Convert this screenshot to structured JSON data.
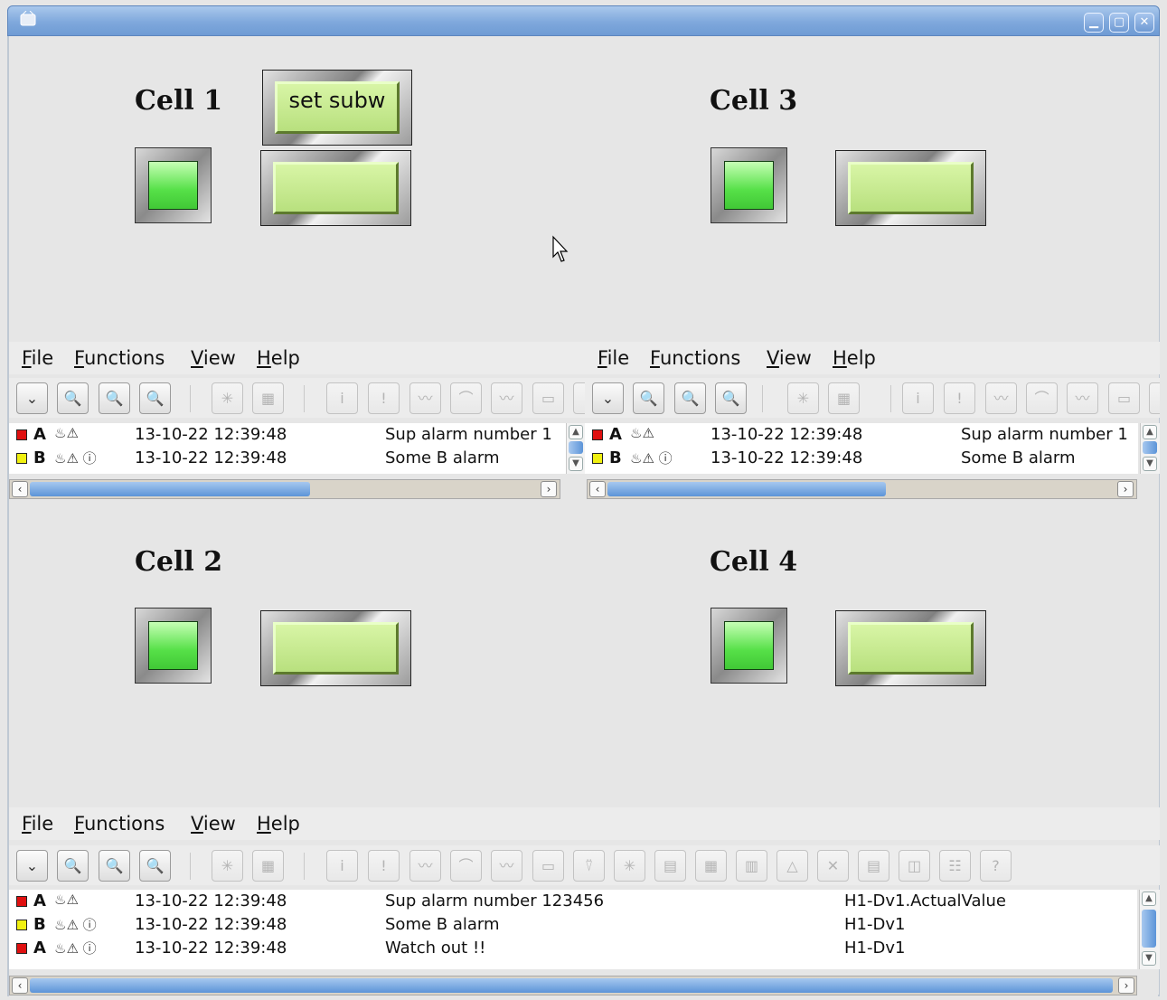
{
  "window": {
    "controls": {
      "minimize": "▁",
      "maximize": "▢",
      "close": "✕"
    }
  },
  "cells": [
    {
      "title": "Cell 1",
      "button_label": "set subw"
    },
    {
      "title": "Cell 3"
    },
    {
      "title": "Cell 2"
    },
    {
      "title": "Cell 4"
    }
  ],
  "menu": {
    "file": "File",
    "functions": "Functions",
    "view": "View",
    "help": "Help"
  },
  "colors": {
    "prio_a": "#e01010",
    "prio_b": "#f0f010",
    "lamp": "#4fdc40",
    "button_face": "#c6e88f"
  },
  "alarms": [
    {
      "prio": "A",
      "icons": "♨⚠",
      "time": "13-10-22 12:39:48",
      "text": "Sup alarm number 123456",
      "object": "H1-Dv1.ActualValue"
    },
    {
      "prio": "B",
      "icons": "♨⚠ ⓘ",
      "time": "13-10-22 12:39:48",
      "text": "Some B alarm",
      "object": "H1-Dv1"
    },
    {
      "prio": "A",
      "icons": "♨⚠ ⓘ",
      "time": "13-10-22 12:39:48",
      "text": "Watch out !!",
      "object": "H1-Dv1"
    }
  ],
  "alarms_truncated": {
    "text_pane1_row1": "Sup alarm number 1",
    "text_pane2_row1": "Sup alarm number 1"
  },
  "toolbar_icons": [
    "expand-icon",
    "zoom-in-icon",
    "zoom-icon",
    "zoom-reset-icon",
    "navigator-icon",
    "object-graph-icon",
    "info-icon",
    "acknowledge-icon",
    "trend-icon",
    "history-icon",
    "fast-curve-icon",
    "display-icon",
    "filter-icon",
    "crossref-icon",
    "doc-icon",
    "graph-icon",
    "note-icon",
    "warning-icon",
    "block-icon",
    "list-icon",
    "plot-icon",
    "table-icon",
    "help-icon"
  ]
}
